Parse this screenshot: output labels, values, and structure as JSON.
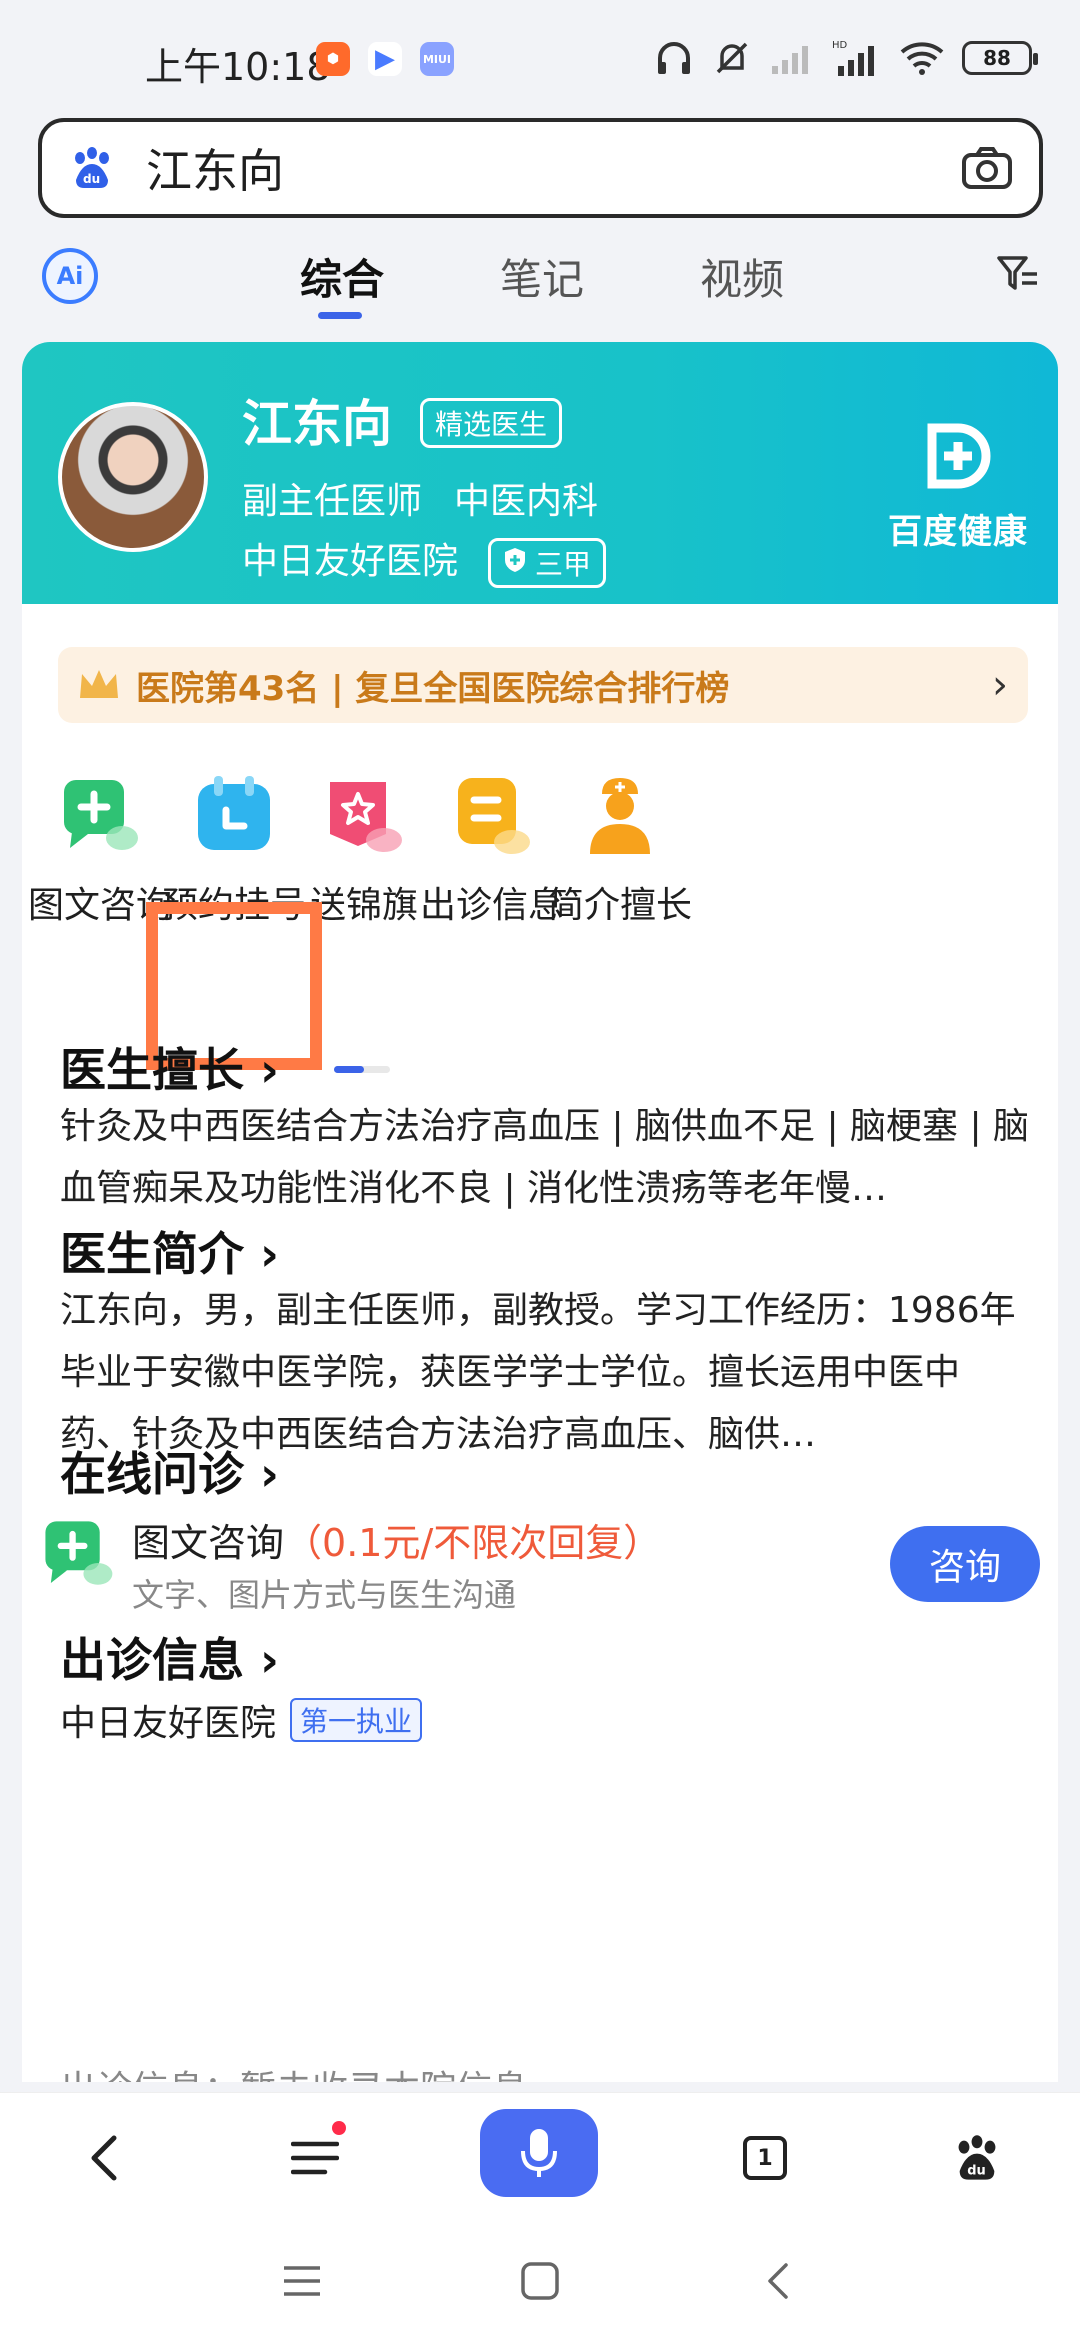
{
  "status_bar": {
    "time": "上午10:18",
    "battery": "88",
    "apps": [
      "",
      "",
      "MIUI"
    ]
  },
  "search": {
    "query": "江东向"
  },
  "tabs": {
    "ai": "Ai",
    "items": [
      "综合",
      "笔记",
      "视频"
    ]
  },
  "doctor": {
    "name": "江东向",
    "badge": "精选医生",
    "title": "副主任医师",
    "department": "中医内科",
    "hospital": "中日友好医院",
    "hospital_level": "三甲",
    "brand": "百度健康"
  },
  "ranking": {
    "text": "医院第43名 | 复旦全国医院综合排行榜"
  },
  "services": [
    {
      "label": "图文咨询",
      "icon": "chat-plus-icon",
      "color": "#2fc274"
    },
    {
      "label": "预约挂号",
      "icon": "calendar-icon",
      "color": "#2fb4ee"
    },
    {
      "label": "送锦旗",
      "icon": "star-banner-icon",
      "color": "#f04d74"
    },
    {
      "label": "出诊信息",
      "icon": "schedule-icon",
      "color": "#f7b21c"
    },
    {
      "label": "简介擅长",
      "icon": "nurse-icon",
      "color": "#f7a21c"
    }
  ],
  "sections": {
    "expertise": {
      "title": "医生擅长",
      "body": "针灸及中西医结合方法治疗高血压 | 脑供血不足 | 脑梗塞 | 脑血管痴呆及功能性消化不良 | 消化性溃疡等老年慢…"
    },
    "intro": {
      "title": "医生简介",
      "body": "江东向，男，副主任医师，副教授。学习工作经历：1986年毕业于安徽中医学院，获医学学士学位。擅长运用中医中药、针灸及中西医结合方法治疗高血压、脑供…"
    },
    "online": {
      "title": "在线问诊",
      "service_name": "图文咨询",
      "price": "（0.1元/不限次回复）",
      "subtitle": "文字、图片方式与医生沟通",
      "button": "咨询"
    },
    "clinic": {
      "title": "出诊信息",
      "hospital": "中日友好医院",
      "badge": "第一执业",
      "clipped_text": "出诊信息：暂未收录本院信息"
    }
  },
  "colors": {
    "accent": "#3f6ff0",
    "highlight": "#ff7a45",
    "header_teal": "#1fc6c2"
  }
}
